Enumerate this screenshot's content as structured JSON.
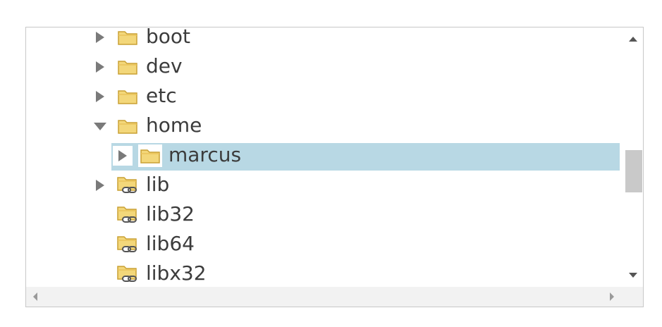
{
  "tree": {
    "items": [
      {
        "label": "boot",
        "expander": "collapsed",
        "icon": "folder-icon",
        "depth": 0
      },
      {
        "label": "dev",
        "expander": "collapsed",
        "icon": "folder-icon",
        "depth": 0
      },
      {
        "label": "etc",
        "expander": "collapsed",
        "icon": "folder-icon",
        "depth": 0
      },
      {
        "label": "home",
        "expander": "expanded",
        "icon": "folder-icon",
        "depth": 0
      },
      {
        "label": "marcus",
        "expander": "collapsed",
        "icon": "folder-icon",
        "depth": 1,
        "selected": true
      },
      {
        "label": "lib",
        "expander": "collapsed",
        "icon": "folder-link-icon",
        "depth": 0
      },
      {
        "label": "lib32",
        "expander": "none",
        "icon": "folder-link-icon",
        "depth": 0
      },
      {
        "label": "lib64",
        "expander": "none",
        "icon": "folder-link-icon",
        "depth": 0
      },
      {
        "label": "libx32",
        "expander": "none",
        "icon": "folder-link-icon",
        "depth": 0
      }
    ]
  },
  "colors": {
    "selection": "#b8d8e4",
    "folder_fill": "#f3d77a",
    "folder_stroke": "#c9a134",
    "expander": "#7a7a7a",
    "text": "#3c3c3c"
  }
}
